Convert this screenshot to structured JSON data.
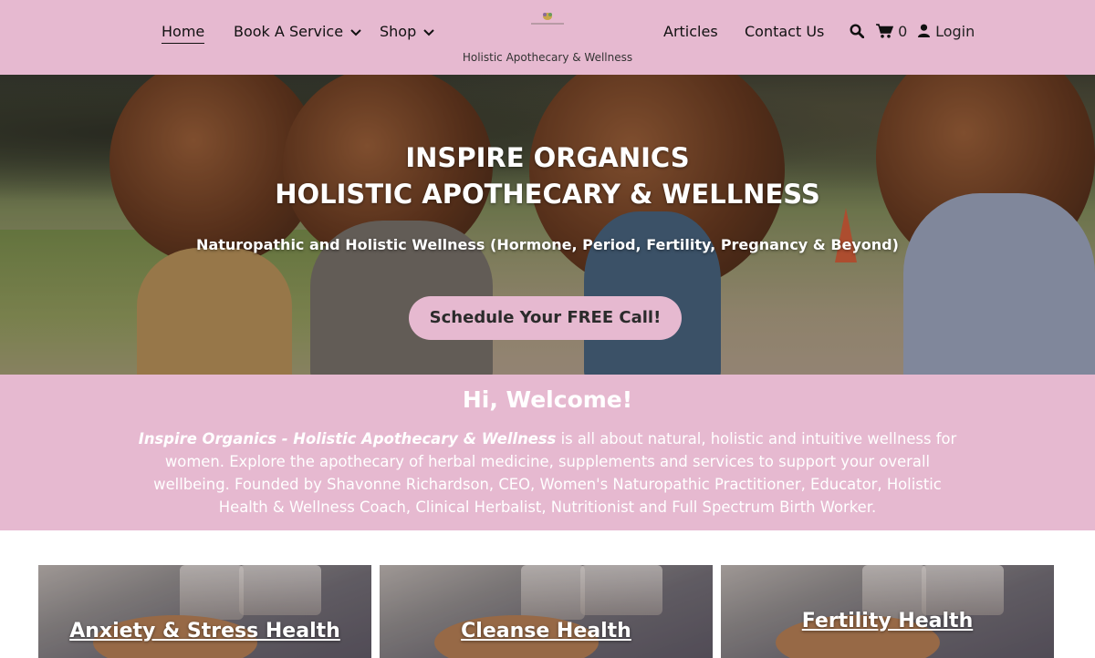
{
  "header": {
    "nav_left": [
      {
        "label": "Home",
        "active": true
      },
      {
        "label": "Book A Service",
        "dropdown": true
      },
      {
        "label": "Shop",
        "dropdown": true
      }
    ],
    "nav_right": [
      {
        "label": "Articles"
      },
      {
        "label": "Contact Us"
      }
    ],
    "cart_count": "0",
    "login_label": "Login",
    "tagline": "Holistic Apothecary & Wellness",
    "colors": {
      "bar": "#e6b9d0",
      "text": "#111111"
    }
  },
  "hero": {
    "title_line1": "INSPIRE ORGANICS",
    "title_line2": "HOLISTIC APOTHECARY & WELLNESS",
    "subtitle": "Naturopathic and Holistic Wellness (Hormone, Period, Fertility, Pregnancy & Beyond)",
    "cta_label": "Schedule Your FREE Call!"
  },
  "welcome": {
    "heading": "Hi, Welcome!",
    "brand": "Inspire Organics - Holistic Apothecary & Wellness",
    "body": " is all about natural, holistic and intuitive wellness for women. Explore the apothecary of herbal medicine, supplements and services to support your overall wellbeing. Founded by Shavonne Richardson, CEO, Women's Naturopathic Practitioner, Educator, Holistic Health & Wellness Coach, Clinical Herbalist, Nutritionist and Full Spectrum Birth Worker."
  },
  "cards": [
    {
      "title": "Anxiety & Stress Health"
    },
    {
      "title": "Cleanse Health"
    },
    {
      "title": "Fertility Health"
    }
  ]
}
